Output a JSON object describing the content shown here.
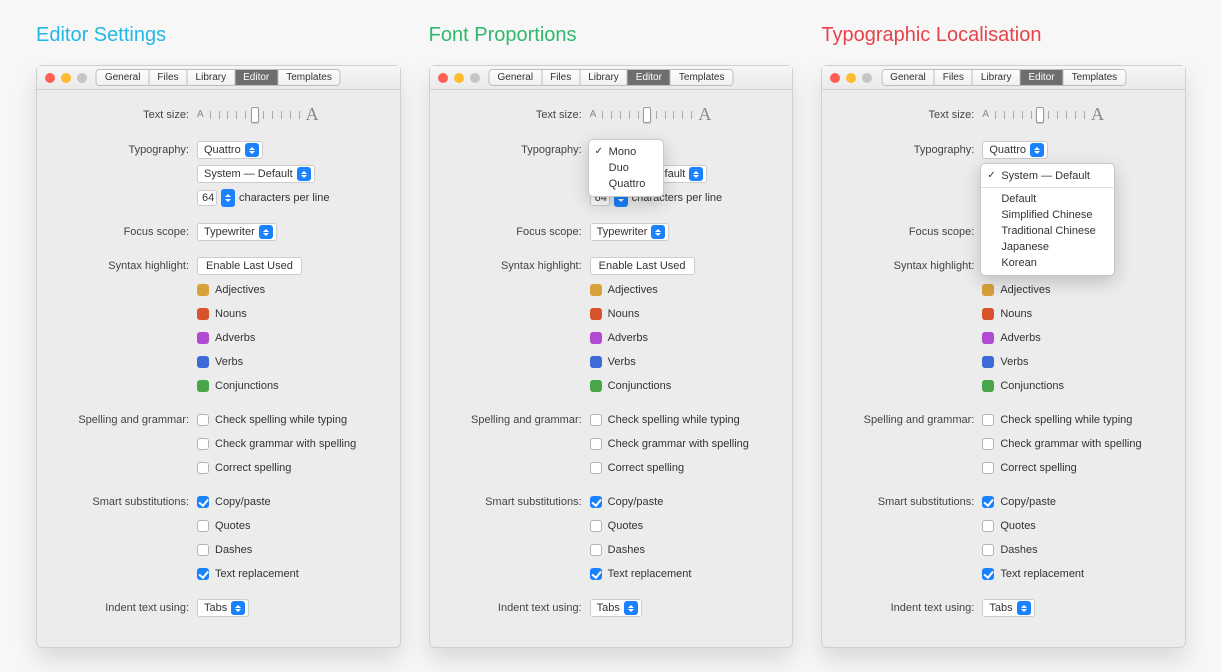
{
  "columns": [
    {
      "title": "Editor Settings"
    },
    {
      "title": "Font Proportions"
    },
    {
      "title": "Typographic Localisation"
    }
  ],
  "tabs": [
    "General",
    "Files",
    "Library",
    "Editor",
    "Templates"
  ],
  "active_tab": "Editor",
  "labels": {
    "text_size": "Text size:",
    "typography": "Typography:",
    "chars_per_line_suffix": "characters per line",
    "focus_scope": "Focus scope:",
    "syntax_highlight": "Syntax highlight:",
    "spelling_grammar": "Spelling and grammar:",
    "smart_subs": "Smart substitutions:",
    "indent": "Indent text using:"
  },
  "values": {
    "typography": "Quattro",
    "system_default": "System — Default",
    "cpl": "64",
    "focus_scope": "Typewriter",
    "syntax_btn": "Enable Last Used",
    "indent": "Tabs"
  },
  "parts_of_speech": [
    {
      "cls": "adj",
      "label": "Adjectives"
    },
    {
      "cls": "noun",
      "label": "Nouns"
    },
    {
      "cls": "adv",
      "label": "Adverbs"
    },
    {
      "cls": "verb",
      "label": "Verbs"
    },
    {
      "cls": "conj",
      "label": "Conjunctions"
    }
  ],
  "spelling_opts": [
    {
      "label": "Check spelling while typing",
      "checked": false
    },
    {
      "label": "Check grammar with spelling",
      "checked": false
    },
    {
      "label": "Correct spelling",
      "checked": false
    }
  ],
  "smart_opts": [
    {
      "label": "Copy/paste",
      "checked": true
    },
    {
      "label": "Quotes",
      "checked": false
    },
    {
      "label": "Dashes",
      "checked": false
    },
    {
      "label": "Text replacement",
      "checked": true
    }
  ],
  "popup_typography": {
    "items": [
      "Mono",
      "Duo",
      "Quattro"
    ],
    "checked": "Mono"
  },
  "popup_locale": {
    "items": [
      "System — Default",
      "Default",
      "Simplified Chinese",
      "Traditional Chinese",
      "Japanese",
      "Korean"
    ],
    "checked": "System — Default",
    "sep_after": 0
  }
}
